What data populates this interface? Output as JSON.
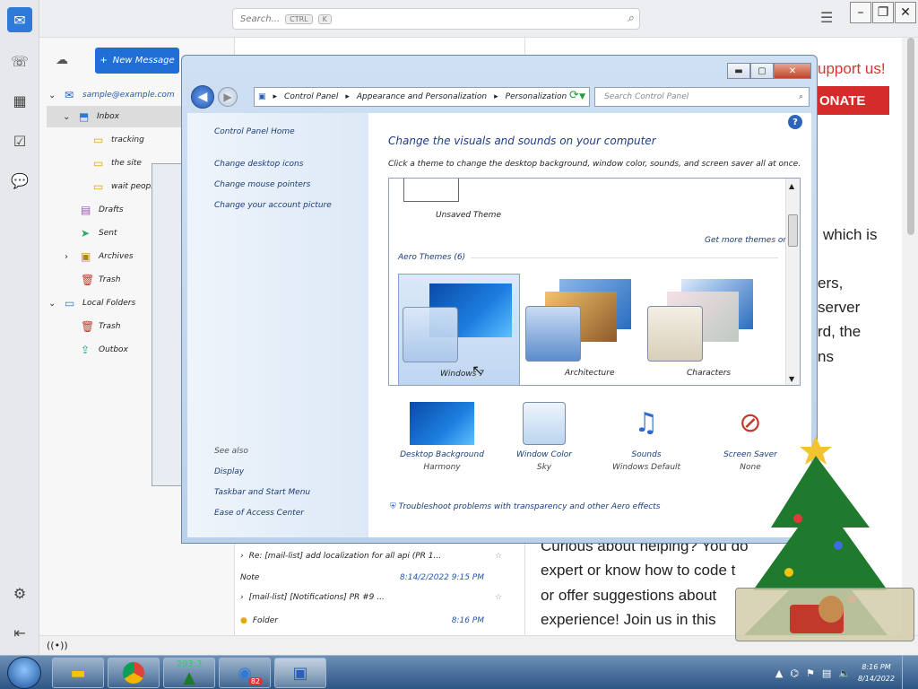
{
  "thunderbird": {
    "search_placeholder": "Search...",
    "search_key1": "CTRL",
    "search_key2": "K",
    "new_message_label": "New Message",
    "account_email": "sample@example.com",
    "folders": [
      {
        "label": "Inbox",
        "icon": "inbox-icon"
      },
      {
        "label": "tracking",
        "icon": "folder-icon"
      },
      {
        "label": "the site",
        "icon": "folder-icon"
      },
      {
        "label": "wait people",
        "icon": "folder-icon"
      },
      {
        "label": "Drafts",
        "icon": "drafts-icon"
      },
      {
        "label": "Sent",
        "icon": "sent-icon"
      },
      {
        "label": "Archives",
        "icon": "archive-icon"
      },
      {
        "label": "Trash",
        "icon": "trash-icon"
      },
      {
        "label": "Local Folders",
        "icon": "local-folder-icon"
      },
      {
        "label": "Trash",
        "icon": "trash-icon"
      },
      {
        "label": "Outbox",
        "icon": "outbox-icon"
      }
    ],
    "messages": [
      {
        "subject": "Re: [mail-list] add localization for all api (PR 1...",
        "date": ""
      },
      {
        "subject": "Note",
        "date": "8:14/2/2022 9:15 PM"
      },
      {
        "subject": "[mail-list] [Notifications] PR #9 ...",
        "date": ""
      },
      {
        "subject": "Folder",
        "date": "8:16 PM"
      }
    ],
    "reader": {
      "support_text": "upport us!",
      "donate_text": "ONATE",
      "lines": [
        "which is",
        "ers,",
        "server",
        "rd, the",
        "ns",
        "Curious about helping? You do",
        "expert or know how to code t",
        "or offer suggestions about",
        "experience! Join us in this"
      ]
    },
    "status_icon": "((•))"
  },
  "control_panel": {
    "breadcrumb": [
      "Control Panel",
      "Appearance and Personalization",
      "Personalization"
    ],
    "search_placeholder": "Search Control Panel",
    "nav": {
      "home": "Control Panel Home",
      "links": [
        "Change desktop icons",
        "Change mouse pointers",
        "Change your account picture"
      ],
      "see_also_title": "See also",
      "see_also": [
        "Display",
        "Taskbar and Start Menu",
        "Ease of Access Center"
      ]
    },
    "heading": "Change the visuals and sounds on your computer",
    "subheading": "Click a theme to change the desktop background, window color, sounds, and screen saver all at once.",
    "unsaved_theme": "Unsaved Theme",
    "get_more": "Get more themes online",
    "aero_group": "Aero Themes (6)",
    "themes": [
      {
        "name": "Windows 7",
        "selected": true
      },
      {
        "name": "Architecture",
        "selected": false
      },
      {
        "name": "Characters",
        "selected": false
      }
    ],
    "bottom": [
      {
        "label": "Desktop Background",
        "value": "Harmony"
      },
      {
        "label": "Window Color",
        "value": "Sky"
      },
      {
        "label": "Sounds",
        "value": "Windows Default"
      },
      {
        "label": "Screen Saver",
        "value": "None"
      }
    ],
    "troubleshoot": "Troubleshoot problems with transparency and other Aero effects"
  },
  "taskbar": {
    "apps": [
      "explorer",
      "chrome",
      "xmas-tree",
      "thunderbird",
      "control-panel"
    ],
    "tree_badge": "293:3",
    "tb_badge": "82",
    "clock_time": "8:16 PM",
    "clock_date": "8/14/2022"
  }
}
